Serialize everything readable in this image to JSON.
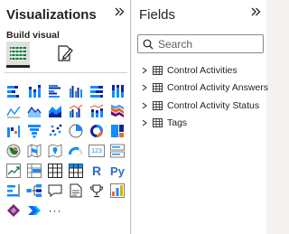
{
  "visualizations": {
    "title": "Visualizations",
    "section_label": "Build visual",
    "tabs": [
      "build-visual-tab",
      "format-visual-tab"
    ],
    "icons": [
      [
        "stacked-bar-icon",
        "stacked-column-icon",
        "clustered-bar-icon",
        "clustered-column-icon",
        "100-stacked-bar-icon",
        "100-stacked-column-icon"
      ],
      [
        "line-chart-icon",
        "area-chart-icon",
        "stacked-area-icon",
        "line-clustered-column-icon",
        "line-stacked-column-icon",
        "ribbon-chart-icon"
      ],
      [
        "waterfall-icon",
        "funnel-icon",
        "scatter-icon",
        "pie-chart-icon",
        "donut-chart-icon",
        "treemap-icon"
      ],
      [
        "map-icon",
        "filled-map-icon",
        "azure-map-icon",
        "gauge-icon",
        "card-icon",
        "multi-row-card-icon"
      ],
      [
        "kpi-icon",
        "slicer-icon",
        "table-icon",
        "matrix-icon",
        "r-visual-icon",
        "python-visual-icon"
      ],
      [
        "key-influencers-icon",
        "decomposition-tree-icon",
        "qa-icon",
        "smart-narrative-icon",
        "paginated-report-icon",
        "goals-icon"
      ],
      [
        "power-apps-icon",
        "power-automate-icon",
        "more-visuals-icon"
      ]
    ],
    "r_glyph": "R",
    "py_glyph": "Py",
    "card_glyph": "123",
    "more_glyph": "···"
  },
  "fields": {
    "title": "Fields",
    "search_placeholder": "Search",
    "tables": [
      {
        "name": "Control Activities"
      },
      {
        "name": "Control Activity Answers"
      },
      {
        "name": "Control Activity Status"
      },
      {
        "name": "Tags"
      }
    ]
  },
  "colors": {
    "accent": "#118dff",
    "dark_blue": "#12239e",
    "orange": "#e66c37",
    "purple": "#6b007b",
    "teal": "#12239e",
    "gold": "#d9b300",
    "text": "#252423"
  }
}
